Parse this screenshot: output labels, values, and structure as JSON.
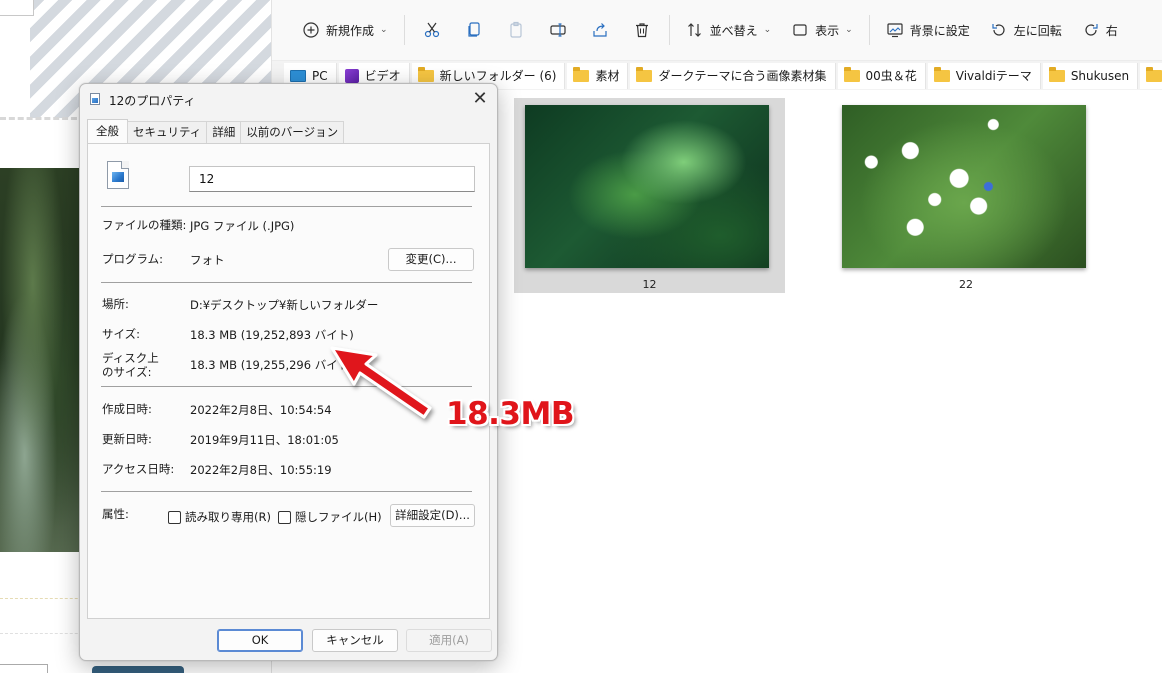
{
  "toolbar": {
    "new_label": "新規作成",
    "sort_label": "並べ替え",
    "view_label": "表示",
    "set_background_label": "背景に設定",
    "rotate_left_label": "左に回転",
    "rotate_right_label": "右"
  },
  "quick_access": [
    {
      "label": "PC",
      "icon": "pc-icon"
    },
    {
      "label": "ビデオ",
      "icon": "video-icon"
    },
    {
      "label": "新しいフォルダー (6)",
      "icon": "folder-icon"
    },
    {
      "label": "素材",
      "icon": "folder-icon"
    },
    {
      "label": "ダークテーマに合う画像素材集",
      "icon": "folder-icon"
    },
    {
      "label": "00虫＆花",
      "icon": "folder-icon"
    },
    {
      "label": "Vivaldiテーマ",
      "icon": "folder-icon"
    },
    {
      "label": "Shukusen",
      "icon": "folder-icon"
    }
  ],
  "files": [
    {
      "name": "12",
      "selected": true
    },
    {
      "name": "22",
      "selected": false
    }
  ],
  "dialog": {
    "title": "12のプロパティ",
    "tabs": [
      "全般",
      "セキュリティ",
      "詳細",
      "以前のバージョン"
    ],
    "active_tab": "全般",
    "file_name": "12",
    "file_type_label": "ファイルの種類:",
    "file_type_value": "JPG ファイル (.JPG)",
    "program_label": "プログラム:",
    "program_value": "フォト",
    "change_button": "変更(C)...",
    "location_label": "場所:",
    "location_value": "D:¥デスクトップ¥新しいフォルダー",
    "size_label": "サイズ:",
    "size_value": "18.3 MB (19,252,893 バイト)",
    "disk_size_label_1": "ディスク上",
    "disk_size_label_2": "のサイズ:",
    "disk_size_value": "18.3 MB (19,255,296 バイト)",
    "created_label": "作成日時:",
    "created_value": "2022年2月8日、10:54:54",
    "modified_label": "更新日時:",
    "modified_value": "2019年9月11日、18:01:05",
    "accessed_label": "アクセス日時:",
    "accessed_value": "2022年2月8日、10:55:19",
    "attributes_label": "属性:",
    "readonly_label": "読み取り専用(R)",
    "hidden_label": "隠しファイル(H)",
    "advanced_button": "詳細設定(D)...",
    "ok_button": "OK",
    "cancel_button": "キャンセル",
    "apply_button": "適用(A)"
  },
  "annotation": {
    "text": "18.3MB",
    "color": "#e0151a"
  }
}
